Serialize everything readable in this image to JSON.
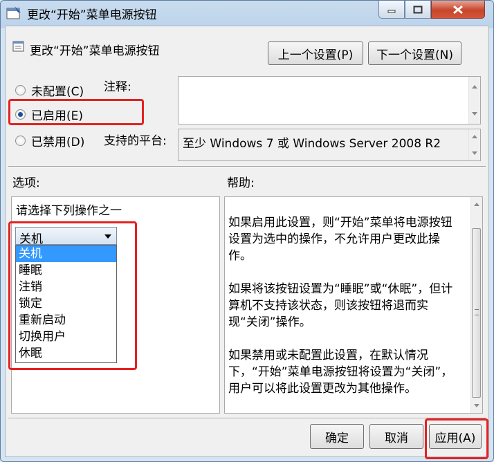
{
  "window": {
    "title": "更改“开始”菜单电源按钮"
  },
  "header": {
    "setting_name": "更改“开始”菜单电源按钮",
    "prev_button": "上一个设置(P)",
    "next_button": "下一个设置(N)"
  },
  "state": {
    "not_configured": "未配置(C)",
    "enabled": "已启用(E)",
    "disabled": "已禁用(D)",
    "selected": "enabled"
  },
  "comment": {
    "label": "注释:",
    "value": ""
  },
  "platform": {
    "label": "支持的平台:",
    "value": "至少 Windows 7 或 Windows Server 2008 R2"
  },
  "options": {
    "label": "选项:",
    "prompt": "请选择下列操作之一",
    "selected_value": "关机",
    "items": [
      "关机",
      "睡眠",
      "注销",
      "锁定",
      "重新启动",
      "切换用户",
      "休眠"
    ]
  },
  "help": {
    "label": "帮助:",
    "paragraphs": [
      "如果启用此设置，则“开始”菜单将电源按钮设置为选中的操作，不允许用户更改此操作。",
      "如果将该按钮设置为“睡眠”或“休眠”，但计算机不支持该状态，则该按钮将退而实现“关闭”操作。",
      "如果禁用或未配置此设置，在默认情况下，“开始”菜单电源按钮将设置为“关闭”，用户可以将此设置更改为其他操作。"
    ]
  },
  "footer": {
    "ok": "确定",
    "cancel": "取消",
    "apply": "应用(A)"
  },
  "colors": {
    "highlight": "#e62121",
    "selection": "#3399ff"
  }
}
